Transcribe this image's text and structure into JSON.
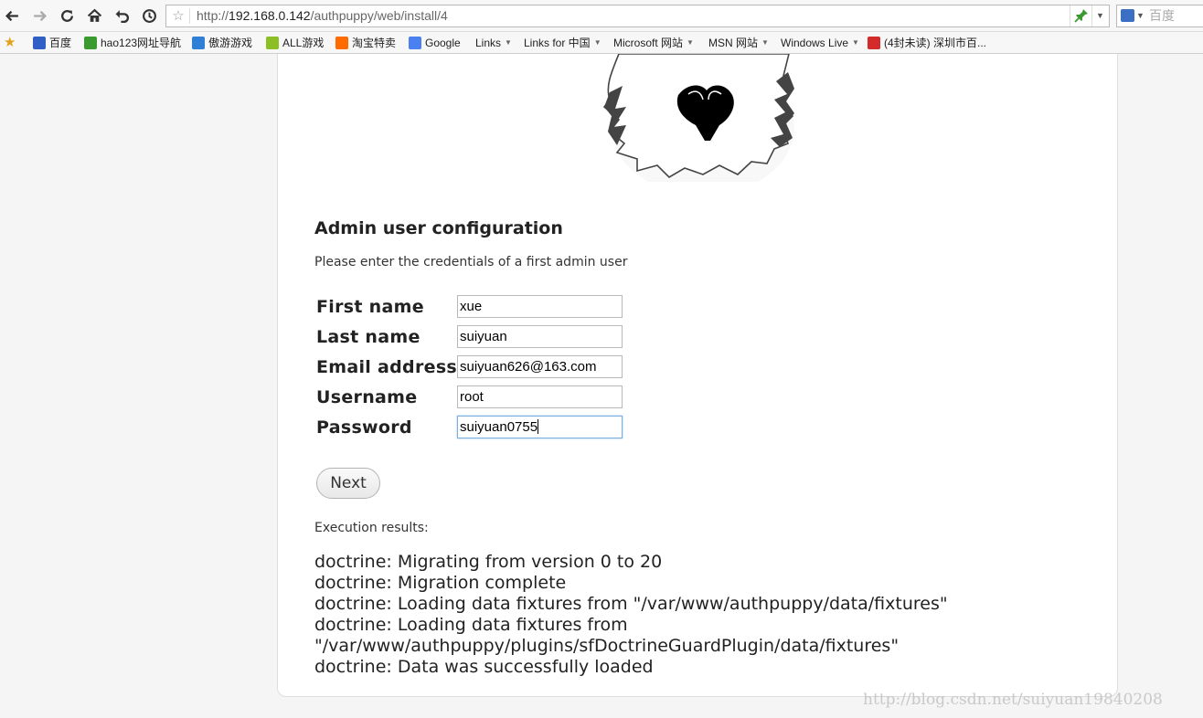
{
  "browser": {
    "url_prefix": "http://",
    "url_host": "192.168.0.142",
    "url_path": "/authpuppy/web/install/4",
    "search_placeholder": "百度",
    "bookmarks": [
      {
        "label": "百度",
        "icon": "baidu-paw-icon",
        "color": "#2f5fc4",
        "dropdown": false
      },
      {
        "label": "hao123网址导航",
        "icon": "hao123-icon",
        "color": "#3a9a2f",
        "dropdown": false
      },
      {
        "label": "傲游游戏",
        "icon": "maxthon-game-icon",
        "color": "#2f7fd6",
        "dropdown": false
      },
      {
        "label": "ALL游戏",
        "icon": "android-game-icon",
        "color": "#8cbf26",
        "dropdown": false
      },
      {
        "label": "淘宝特卖",
        "icon": "taobao-icon",
        "color": "#ff6a00",
        "dropdown": false
      },
      {
        "label": "Google",
        "icon": "google-icon",
        "color": "#4a80f0",
        "dropdown": false
      },
      {
        "label": "Links",
        "icon": "",
        "color": "",
        "dropdown": true
      },
      {
        "label": "Links for 中国",
        "icon": "",
        "color": "",
        "dropdown": true
      },
      {
        "label": "Microsoft 网站",
        "icon": "",
        "color": "",
        "dropdown": true
      },
      {
        "label": "MSN 网站",
        "icon": "",
        "color": "",
        "dropdown": true
      },
      {
        "label": "Windows Live",
        "icon": "",
        "color": "",
        "dropdown": true
      },
      {
        "label": "(4封未读) 深圳市百...",
        "icon": "mail-at-icon",
        "color": "#d42a2a",
        "dropdown": false
      }
    ]
  },
  "page": {
    "heading": "Admin user configuration",
    "intro": "Please enter the credentials of a first admin user",
    "form": [
      {
        "label": "First name",
        "value": "xue"
      },
      {
        "label": "Last name",
        "value": "suiyuan"
      },
      {
        "label": "Email address",
        "value": "suiyuan626@163.com"
      },
      {
        "label": "Username",
        "value": "root"
      },
      {
        "label": "Password",
        "value": "suiyuan0755"
      }
    ],
    "next_label": "Next",
    "exec_label": "Execution results:",
    "results": [
      "doctrine: Migrating from version 0 to 20",
      "doctrine: Migration complete",
      "doctrine: Loading data fixtures from \"/var/www/authpuppy/data/fixtures\"",
      "doctrine: Loading data fixtures from",
      "\"/var/www/authpuppy/plugins/sfDoctrineGuardPlugin/data/fixtures\"",
      "doctrine: Data was successfully loaded"
    ]
  },
  "watermark": "http://blog.csdn.net/suiyuan19840208"
}
